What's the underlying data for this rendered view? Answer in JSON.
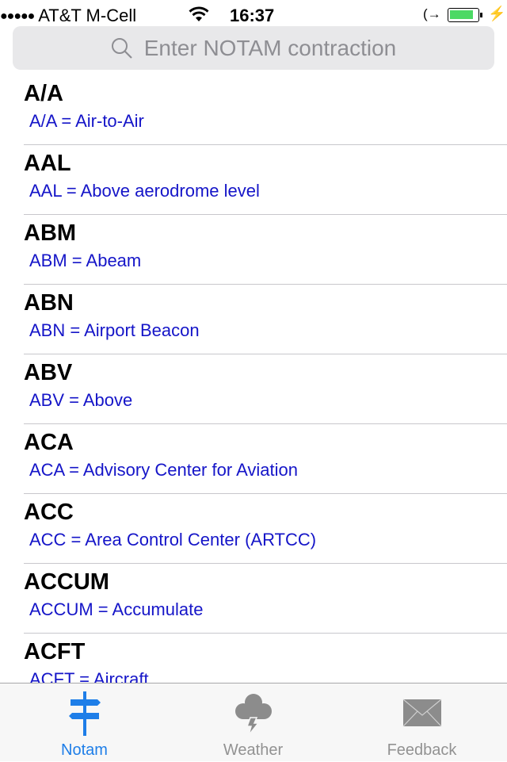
{
  "status_bar": {
    "signal_dots": "●●●●●",
    "carrier": "AT&T M-Cell",
    "time": "16:37",
    "battery_level_percent": 90
  },
  "search": {
    "placeholder": "Enter NOTAM contraction",
    "icon": "search-icon"
  },
  "entries": [
    {
      "code": "A/A",
      "description": "A/A = Air-to-Air"
    },
    {
      "code": "AAL",
      "description": "AAL = Above aerodrome level"
    },
    {
      "code": "ABM",
      "description": "ABM = Abeam"
    },
    {
      "code": "ABN",
      "description": "ABN = Airport Beacon"
    },
    {
      "code": "ABV",
      "description": "ABV = Above"
    },
    {
      "code": "ACA",
      "description": "ACA = Advisory Center for Aviation"
    },
    {
      "code": "ACC",
      "description": "ACC = Area Control Center (ARTCC)"
    },
    {
      "code": "ACCUM",
      "description": "ACCUM = Accumulate"
    },
    {
      "code": "ACFT",
      "description": "ACFT = Aircraft"
    }
  ],
  "tabs": [
    {
      "label": "Notam",
      "icon": "signpost-icon",
      "active": true
    },
    {
      "label": "Weather",
      "icon": "storm-cloud-icon",
      "active": false
    },
    {
      "label": "Feedback",
      "icon": "envelope-icon",
      "active": false
    }
  ],
  "colors": {
    "accent": "#1e7ee8",
    "description_text": "#1515c8",
    "inactive_tab": "#929292",
    "battery": "#4cd964"
  }
}
